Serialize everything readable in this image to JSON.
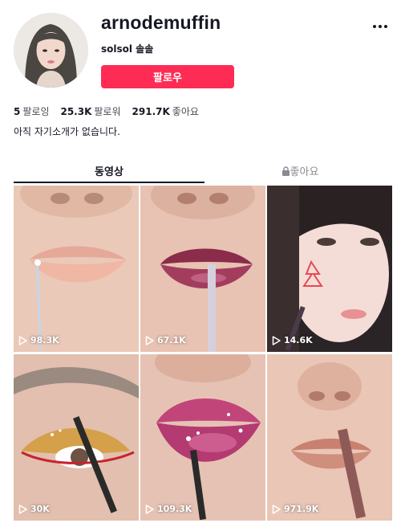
{
  "profile": {
    "username": "arnodemuffin",
    "nickname": "solsol 솔솔",
    "follow_label": "팔로우",
    "bio": "아직 자기소개가 없습니다."
  },
  "stats": [
    {
      "value": "5",
      "label": "팔로잉"
    },
    {
      "value": "25.3K",
      "label": "팔로워"
    },
    {
      "value": "291.7K",
      "label": "좋아요"
    }
  ],
  "tabs": {
    "videos": "동영상",
    "liked": "좋아요"
  },
  "videos": [
    {
      "views": "98.3K",
      "icon": "play-icon"
    },
    {
      "views": "67.1K",
      "icon": "play-icon"
    },
    {
      "views": "14.6K",
      "icon": "play-icon"
    },
    {
      "views": "30K",
      "icon": "play-icon"
    },
    {
      "views": "109.3K",
      "icon": "play-icon"
    },
    {
      "views": "971.9K",
      "icon": "play-icon"
    }
  ],
  "colors": {
    "accent": "#fe2c55",
    "text": "#161823",
    "muted": "#8a8b91"
  }
}
